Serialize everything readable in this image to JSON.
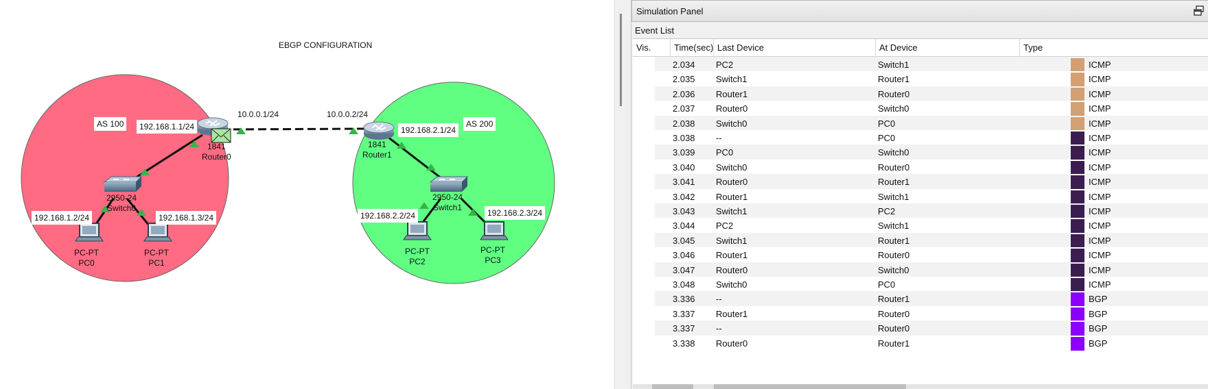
{
  "topology": {
    "title": "EBGP CONFIGURATION",
    "as_left": "AS 100",
    "as_right": "AS 200",
    "left_color": "#ff6b82",
    "right_color": "#60ff82",
    "links": {
      "r0_wan_ip": "10.0.0.1/24",
      "r1_wan_ip": "10.0.0.2/24",
      "r0_lan_ip": "192.168.1.1/24",
      "r1_lan_ip": "192.168.2.1/24",
      "pc0_ip": "192.168.1.2/24",
      "pc1_ip": "192.168.1.3/24",
      "pc2_ip": "192.168.2.2/24",
      "pc3_ip": "192.168.2.3/24"
    },
    "devices": {
      "router0": {
        "model": "1841",
        "name": "Router0"
      },
      "router1": {
        "model": "1841",
        "name": "Router1"
      },
      "switch0": {
        "model": "2950-24",
        "name": "Switch0"
      },
      "switch1": {
        "model": "2950-24",
        "name": "Switch1"
      },
      "pc0": {
        "model": "PC-PT",
        "name": "PC0"
      },
      "pc1": {
        "model": "PC-PT",
        "name": "PC1"
      },
      "pc2": {
        "model": "PC-PT",
        "name": "PC2"
      },
      "pc3": {
        "model": "PC-PT",
        "name": "PC3"
      }
    }
  },
  "simulation_panel": {
    "title": "Simulation Panel",
    "event_list_label": "Event List",
    "columns": [
      "Vis.",
      "Time(sec)",
      "Last Device",
      "At Device",
      "Type"
    ],
    "events": [
      {
        "time": "2.034",
        "last": "PC2",
        "at": "Switch1",
        "type": "ICMP",
        "color": "#d2a072"
      },
      {
        "time": "2.035",
        "last": "Switch1",
        "at": "Router1",
        "type": "ICMP",
        "color": "#d2a072"
      },
      {
        "time": "2.036",
        "last": "Router1",
        "at": "Router0",
        "type": "ICMP",
        "color": "#d2a072"
      },
      {
        "time": "2.037",
        "last": "Router0",
        "at": "Switch0",
        "type": "ICMP",
        "color": "#d2a072"
      },
      {
        "time": "2.038",
        "last": "Switch0",
        "at": "PC0",
        "type": "ICMP",
        "color": "#d2a072"
      },
      {
        "time": "3.038",
        "last": "--",
        "at": "PC0",
        "type": "ICMP",
        "color": "#3b1e4f"
      },
      {
        "time": "3.039",
        "last": "PC0",
        "at": "Switch0",
        "type": "ICMP",
        "color": "#3b1e4f"
      },
      {
        "time": "3.040",
        "last": "Switch0",
        "at": "Router0",
        "type": "ICMP",
        "color": "#3b1e4f"
      },
      {
        "time": "3.041",
        "last": "Router0",
        "at": "Router1",
        "type": "ICMP",
        "color": "#3b1e4f"
      },
      {
        "time": "3.042",
        "last": "Router1",
        "at": "Switch1",
        "type": "ICMP",
        "color": "#3b1e4f"
      },
      {
        "time": "3.043",
        "last": "Switch1",
        "at": "PC2",
        "type": "ICMP",
        "color": "#3b1e4f"
      },
      {
        "time": "3.044",
        "last": "PC2",
        "at": "Switch1",
        "type": "ICMP",
        "color": "#3b1e4f"
      },
      {
        "time": "3.045",
        "last": "Switch1",
        "at": "Router1",
        "type": "ICMP",
        "color": "#3b1e4f"
      },
      {
        "time": "3.046",
        "last": "Router1",
        "at": "Router0",
        "type": "ICMP",
        "color": "#3b1e4f"
      },
      {
        "time": "3.047",
        "last": "Router0",
        "at": "Switch0",
        "type": "ICMP",
        "color": "#3b1e4f"
      },
      {
        "time": "3.048",
        "last": "Switch0",
        "at": "PC0",
        "type": "ICMP",
        "color": "#3b1e4f"
      },
      {
        "time": "3.336",
        "last": "--",
        "at": "Router1",
        "type": "BGP",
        "color": "#8b00ff"
      },
      {
        "time": "3.337",
        "last": "Router1",
        "at": "Router0",
        "type": "BGP",
        "color": "#8b00ff"
      },
      {
        "time": "3.337",
        "last": "--",
        "at": "Router0",
        "type": "BGP",
        "color": "#8b00ff"
      },
      {
        "time": "3.338",
        "last": "Router0",
        "at": "Router1",
        "type": "BGP",
        "color": "#8b00ff"
      }
    ]
  }
}
